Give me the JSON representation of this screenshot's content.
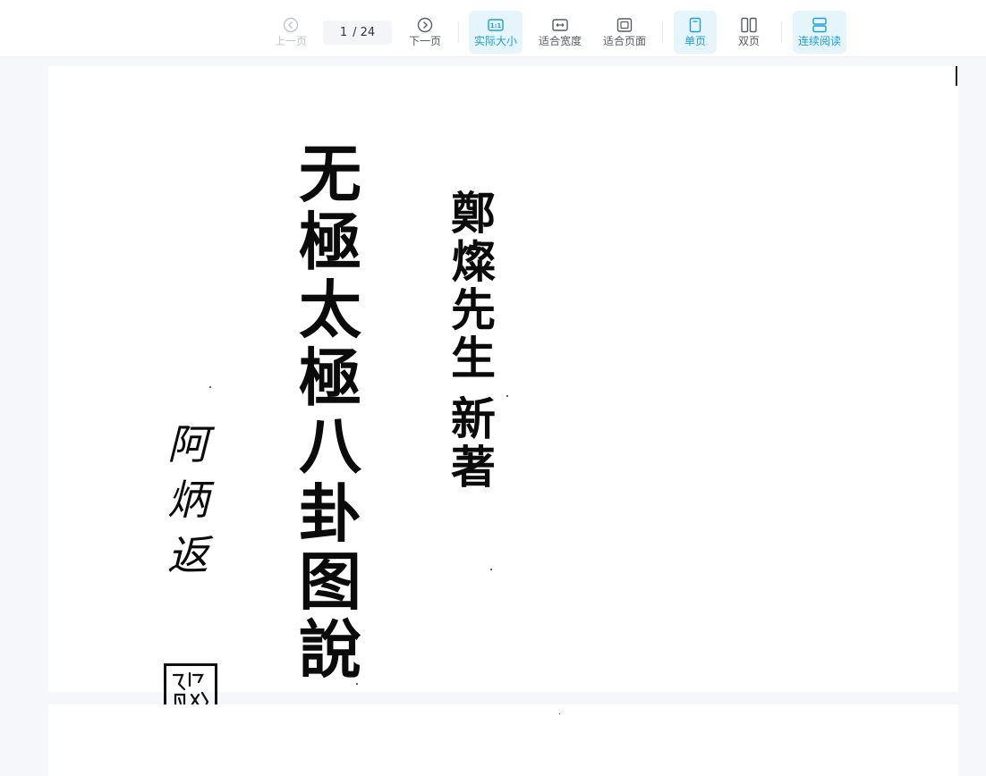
{
  "toolbar": {
    "prev": {
      "label": "上一页",
      "icon": "chevron-left-circle-icon",
      "disabled": true
    },
    "page_indicator": {
      "current": "1",
      "total": "/ 24"
    },
    "next": {
      "label": "下一页",
      "icon": "chevron-right-circle-icon"
    },
    "actual_size": {
      "label": "实际大小",
      "icon": "actual-size-icon",
      "active": true,
      "icon_text": "1:1"
    },
    "fit_width": {
      "label": "适合宽度",
      "icon": "fit-width-icon"
    },
    "fit_page": {
      "label": "适合页面",
      "icon": "fit-page-icon"
    },
    "single_page": {
      "label": "单页",
      "icon": "single-page-icon",
      "active": true
    },
    "double_page": {
      "label": "双页",
      "icon": "double-page-icon"
    },
    "continuous": {
      "label": "连续阅读",
      "icon": "continuous-reading-icon",
      "active": true
    }
  },
  "colors": {
    "accent": "#1aa0d8",
    "accent_bg": "#e6f4fb",
    "disabled": "#c0c4cc",
    "viewer_bg": "#f5f7fa"
  },
  "document": {
    "title_chars": [
      "无",
      "極",
      "太",
      "極",
      "八",
      "卦",
      "图",
      "說"
    ],
    "author_chars": [
      "鄭",
      "燦",
      "先",
      "生",
      "新",
      "著"
    ],
    "signature_chars": [
      "阿",
      "炳",
      "返"
    ],
    "seal_text": "阿炳"
  }
}
